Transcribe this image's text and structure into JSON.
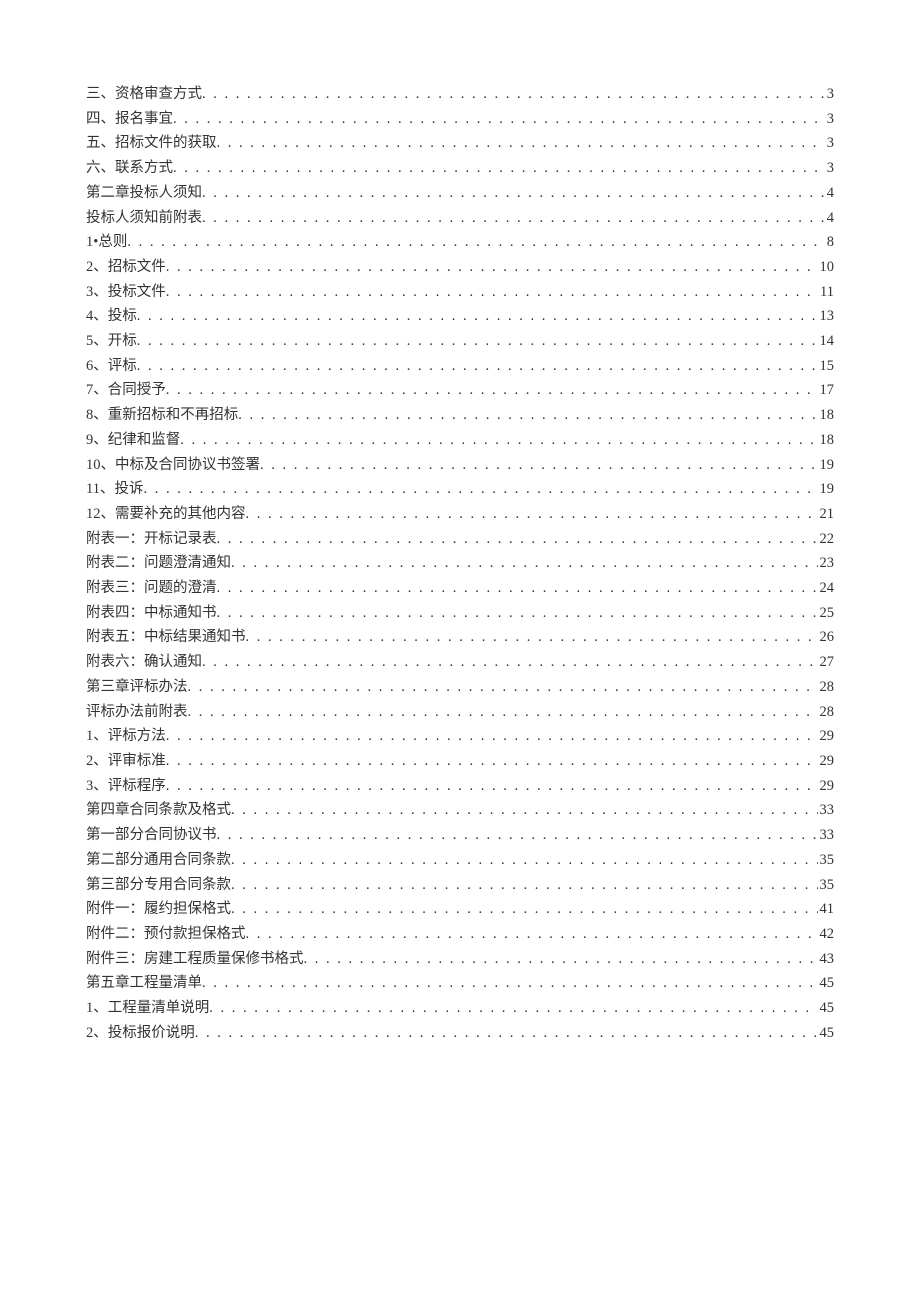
{
  "toc": [
    {
      "label": "三、资格审查方式",
      "page": "3"
    },
    {
      "label": "四、报名事宜",
      "page": "3"
    },
    {
      "label": "五、招标文件的获取",
      "page": "3"
    },
    {
      "label": "六、联系方式",
      "page": "3"
    },
    {
      "label": "第二章投标人须知",
      "page": "4"
    },
    {
      "label": "投标人须知前附表",
      "page": "4"
    },
    {
      "label": "1•总则",
      "page": "8"
    },
    {
      "label": "2、招标文件",
      "page": "10"
    },
    {
      "label": "3、投标文件",
      "page": "11"
    },
    {
      "label": "4、投标",
      "page": "13"
    },
    {
      "label": "5、开标",
      "page": "14"
    },
    {
      "label": "6、评标",
      "page": "15"
    },
    {
      "label": "7、合同授予",
      "page": "17"
    },
    {
      "label": "8、重新招标和不再招标",
      "page": "18"
    },
    {
      "label": "9、纪律和监督",
      "page": "18"
    },
    {
      "label": "10、中标及合同协议书签署",
      "page": "19"
    },
    {
      "label": "11、投诉",
      "page": "19"
    },
    {
      "label": "12、需要补充的其他内容",
      "page": "21"
    },
    {
      "label": "附表一：开标记录表",
      "page": "22"
    },
    {
      "label": "附表二：问题澄清通知",
      "page": "23"
    },
    {
      "label": "附表三：问题的澄清",
      "page": "24"
    },
    {
      "label": "附表四：中标通知书",
      "page": "25"
    },
    {
      "label": "附表五：中标结果通知书",
      "page": "26"
    },
    {
      "label": "附表六：确认通知",
      "page": "27"
    },
    {
      "label": "第三章评标办法",
      "page": "28"
    },
    {
      "label": "评标办法前附表",
      "page": "28"
    },
    {
      "label": "1、评标方法",
      "page": "29"
    },
    {
      "label": "2、评审标准",
      "page": "29"
    },
    {
      "label": "3、评标程序",
      "page": "29"
    },
    {
      "label": "第四章合同条款及格式",
      "page": "33"
    },
    {
      "label": "第一部分合同协议书",
      "page": "33"
    },
    {
      "label": "第二部分通用合同条款",
      "page": "35"
    },
    {
      "label": "第三部分专用合同条款",
      "page": "35"
    },
    {
      "label": "附件一：履约担保格式",
      "page": "41"
    },
    {
      "label": "附件二：预付款担保格式",
      "page": "42"
    },
    {
      "label": "附件三：房建工程质量保修书格式",
      "page": "43"
    },
    {
      "label": "第五章工程量清单",
      "page": "45"
    },
    {
      "label": "1、工程量清单说明",
      "page": "45"
    },
    {
      "label": "2、投标报价说明",
      "page": "45"
    }
  ]
}
